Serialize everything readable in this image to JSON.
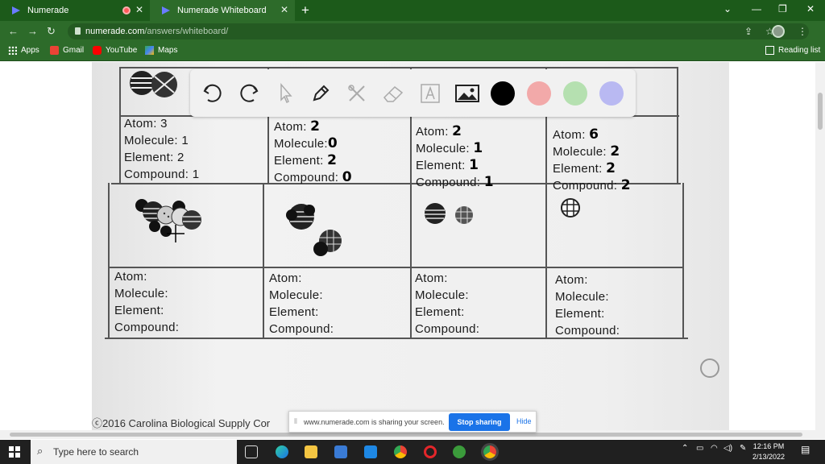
{
  "browser": {
    "tabs": [
      {
        "label": "Numerade"
      },
      {
        "label": "Numerade Whiteboard"
      }
    ],
    "url_host": "numerade.com",
    "url_path": "/answers/whiteboard/",
    "bookmarks": [
      "Apps",
      "Gmail",
      "YouTube",
      "Maps"
    ],
    "reading_list": "Reading list"
  },
  "worksheet": {
    "row1": [
      {
        "atom": "Atom: 3",
        "molecule": "Molecule: 1",
        "element": "Element: 2",
        "compound": "Compound: 1"
      },
      {
        "atom": "Atom:",
        "molecule": "Molecule:",
        "element": "Element:",
        "compound": "Compound:",
        "hand": [
          "2",
          "0",
          "2",
          "0"
        ]
      },
      {
        "atom": "Atom:",
        "molecule": "Molecule:",
        "element": "Element:",
        "compound": "Compound:",
        "hand": [
          "2",
          "1",
          "1",
          "1"
        ]
      },
      {
        "atom": "Atom:",
        "molecule": "Molecule:",
        "element": "Element:",
        "compound": "Compound:",
        "hand": [
          "6",
          "2",
          "2",
          "2"
        ]
      }
    ],
    "row2": [
      {
        "atom": "Atom:",
        "molecule": "Molecule:",
        "element": "Element:",
        "compound": "Compound:"
      },
      {
        "atom": "Atom:",
        "molecule": "Molecule:",
        "element": "Element:",
        "compound": "Compound:"
      },
      {
        "atom": "Atom:",
        "molecule": "Molecule:",
        "element": "Element:",
        "compound": "Compound:"
      },
      {
        "atom": "Atom:",
        "molecule": "Molecule:",
        "element": "Element:",
        "compound": "Compound:"
      }
    ],
    "copyright": "2016 Carolina Biological Supply Cor"
  },
  "toolbar": {
    "tools": [
      "undo-icon",
      "redo-icon",
      "pointer-icon",
      "pen-icon",
      "tools-icon",
      "eraser-icon",
      "text-icon",
      "image-icon"
    ],
    "colors": [
      "#000000",
      "#f2a9a9",
      "#b5e0b0",
      "#b9b9f2"
    ]
  },
  "share_bar": {
    "message": "www.numerade.com is sharing your screen.",
    "stop_label": "Stop sharing",
    "hide_label": "Hide"
  },
  "taskbar": {
    "search_placeholder": "Type here to search",
    "time": "12:16 PM",
    "date": "2/13/2022"
  }
}
